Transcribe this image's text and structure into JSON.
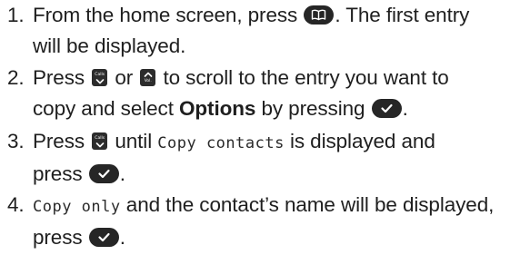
{
  "steps": [
    {
      "number": "1.",
      "line1_before": "From the home screen, press",
      "line1_after": ". The first entry",
      "line2": "will be displayed."
    },
    {
      "number": "2.",
      "press": "Press",
      "or": "or",
      "line1_after": "to scroll to the entry you want to",
      "line2_before": "copy and select",
      "line2_bold": "Options",
      "line2_mid": "by pressing",
      "line2_end": "."
    },
    {
      "number": "3.",
      "press": "Press",
      "until": "until",
      "display_text": "Copy contacts",
      "line1_after": "is displayed and",
      "line2_before": "press",
      "line2_end": "."
    },
    {
      "number": "4.",
      "display_text": "Copy only",
      "line1_after": "and the contact’s name will be displayed,",
      "line2_before": "press",
      "line2_end": "."
    }
  ],
  "keys": {
    "calls_label": "Calls",
    "vol_label": "Vol."
  },
  "icons": {
    "phonebook": "phonebook-icon",
    "ok": "checkmark-icon",
    "calls_down": "calls-down-key-icon",
    "vol_up": "vol-up-key-icon"
  },
  "colors": {
    "text": "#1f1f1f",
    "key_fill": "#262626",
    "key_glyph": "#ffffff"
  }
}
